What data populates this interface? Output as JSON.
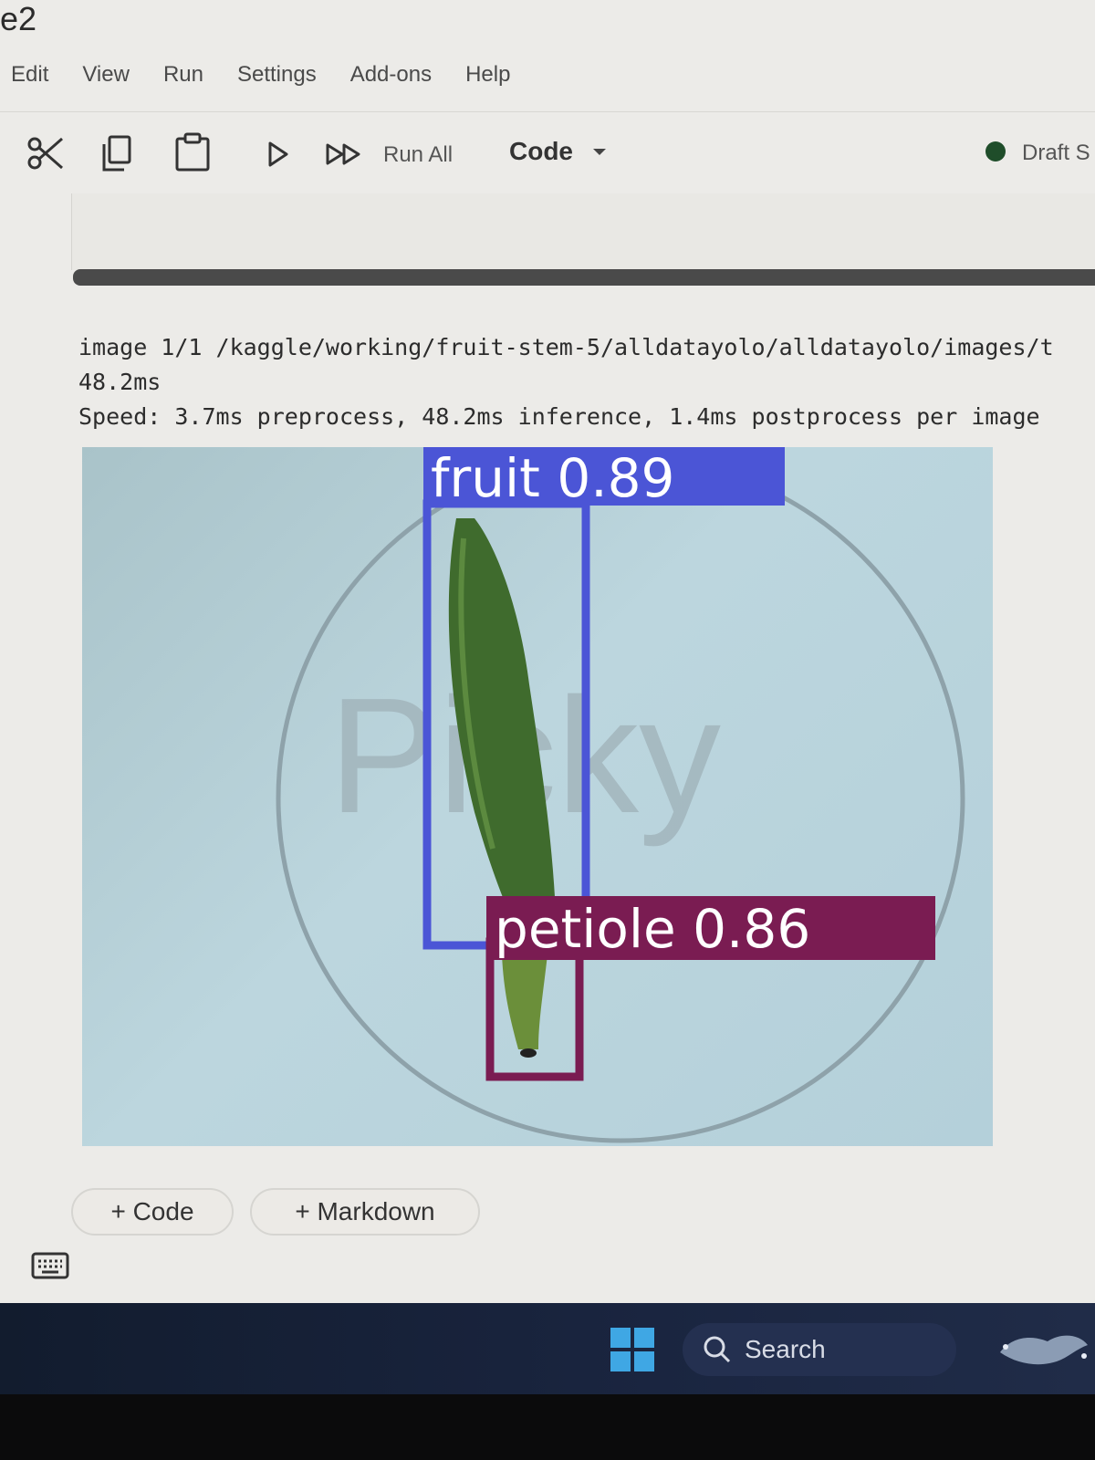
{
  "window": {
    "title_fragment": "e2"
  },
  "menu": [
    "Edit",
    "View",
    "Run",
    "Settings",
    "Add-ons",
    "Help"
  ],
  "toolbar": {
    "run_all_label": "Run All",
    "cell_type": "Code",
    "status": "Draft S"
  },
  "output": {
    "lines": [
      "image 1/1 /kaggle/working/fruit-stem-5/alldatayolo/alldatayolo/images/t",
      "48.2ms",
      "Speed: 3.7ms preprocess, 48.2ms inference, 1.4ms postprocess per image"
    ],
    "image": {
      "watermark": "Picky",
      "detections": [
        {
          "label": "fruit 0.89",
          "color": "#4b55d6"
        },
        {
          "label": "petiole 0.86",
          "color": "#7a1c52"
        }
      ]
    }
  },
  "add_cell": {
    "code_label": "+ Code",
    "markdown_label": "+ Markdown"
  },
  "taskbar": {
    "search_label": "Search",
    "accent_color": "#3fa7e4"
  }
}
